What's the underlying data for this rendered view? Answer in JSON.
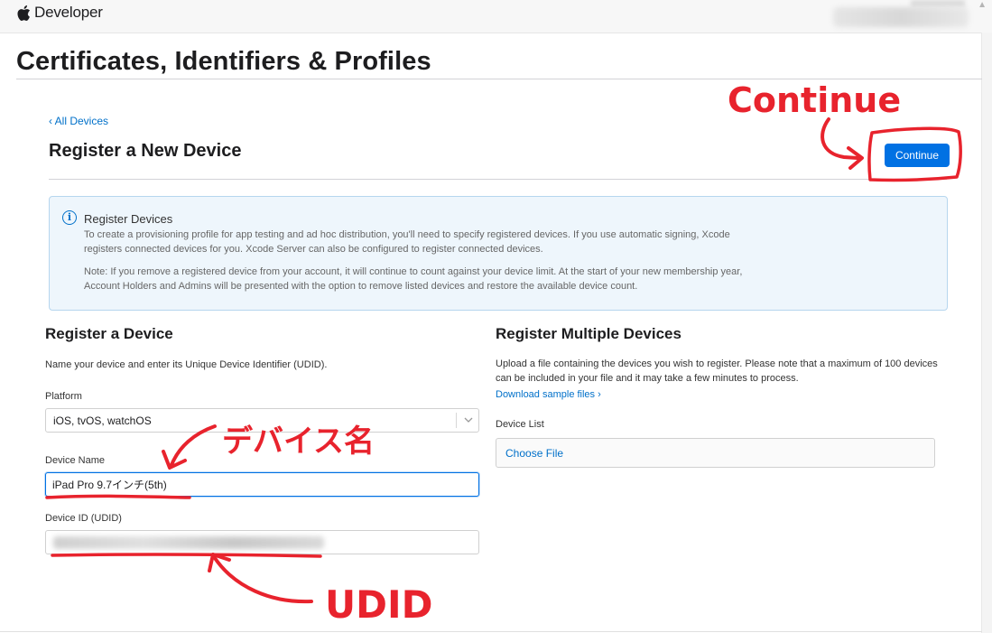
{
  "header": {
    "brand": "Developer"
  },
  "page": {
    "title": "Certificates, Identifiers & Profiles",
    "back_link": "‹ All Devices",
    "section_title": "Register a New Device",
    "continue_label": "Continue"
  },
  "info": {
    "title": "Register Devices",
    "p1": "To create a provisioning profile for app testing and ad hoc distribution, you'll need to specify registered devices. If you use automatic signing, Xcode registers connected devices for you. Xcode Server can also be configured to register connected devices.",
    "p2": "Note: If you remove a registered device from your account, it will continue to count against your device limit. At the start of your new membership year, Account Holders and Admins will be presented with the option to remove listed devices and restore the available device count."
  },
  "single": {
    "title": "Register a Device",
    "description": "Name your device and enter its Unique Device Identifier (UDID).",
    "platform_label": "Platform",
    "platform_value": "iOS, tvOS, watchOS",
    "device_name_label": "Device Name",
    "device_name_value": "iPad Pro 9.7インチ(5th)",
    "udid_label": "Device ID (UDID)"
  },
  "multiple": {
    "title": "Register Multiple Devices",
    "description": "Upload a file containing the devices you wish to register. Please note that a maximum of 100 devices can be included in your file and it may take a few minutes to process.",
    "download_link": "Download sample files ›",
    "list_label": "Device List",
    "choose_file": "Choose File"
  },
  "annotations": {
    "continue": "Continue",
    "device_name": "デバイス名",
    "udid": "UDID"
  },
  "colors": {
    "accent": "#0071e3",
    "link": "#0070c9",
    "annotation": "#e8232d"
  }
}
